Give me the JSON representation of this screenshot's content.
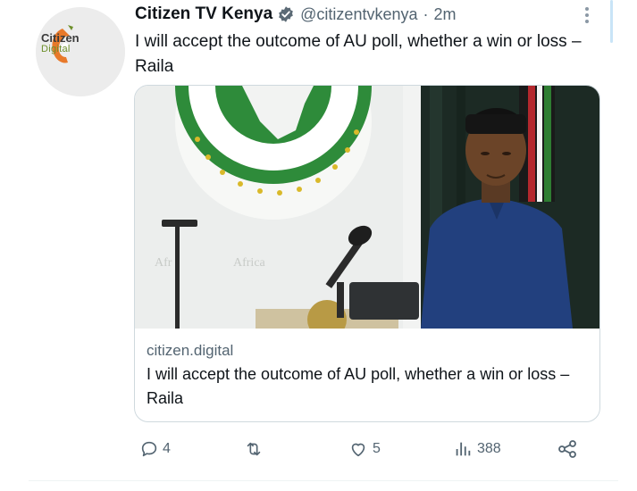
{
  "tweet": {
    "display_name": "Citizen TV Kenya",
    "handle": "@citizentvkenya",
    "separator": "·",
    "time": "2m",
    "text": "I will accept the outcome of AU poll, whether a win or loss – Raila",
    "verified": true
  },
  "avatar": {
    "logo_line1": "Citizen",
    "logo_line2": "Digital",
    "colors": {
      "orange": "#e8792a",
      "green": "#6d8f2b"
    }
  },
  "card": {
    "domain": "citizen.digital",
    "title": "I will accept the outcome of AU poll, whether a win or loss – Raila",
    "image_alt_icon": "photo-of-speaker-at-au-podium"
  },
  "actions": {
    "reply": {
      "icon": "reply-icon",
      "count": "4"
    },
    "retweet": {
      "icon": "retweet-icon",
      "count": ""
    },
    "like": {
      "icon": "heart-icon",
      "count": "5"
    },
    "views": {
      "icon": "views-icon",
      "count": "388"
    },
    "share": {
      "icon": "share-icon",
      "count": ""
    }
  },
  "colors": {
    "text": "#0f1419",
    "secondary": "#536471",
    "verified": "#1d9bf0",
    "border": "#cfd9de"
  }
}
